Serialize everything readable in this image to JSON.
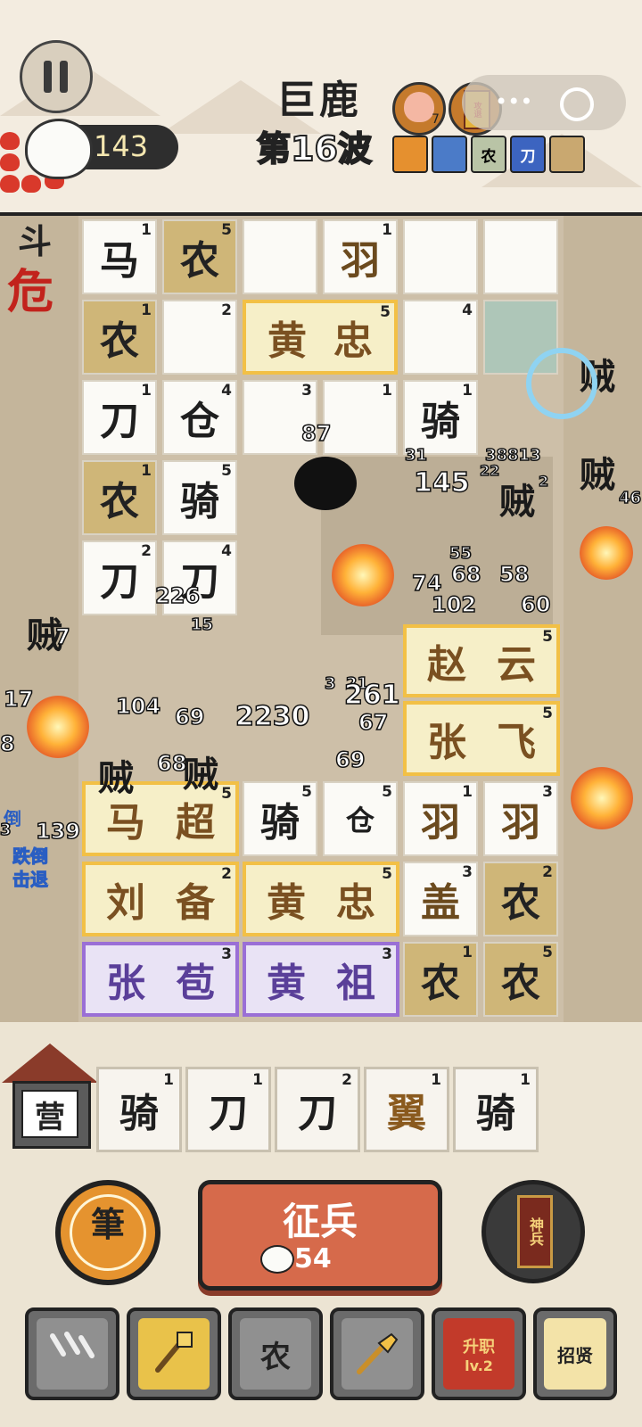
{
  "header": {
    "boss_name": "巨鹿",
    "wave": "第16波",
    "currency": "143",
    "peach_count": "7",
    "token_label": "攻退",
    "buffs": [
      "",
      "",
      "农",
      "刀",
      ""
    ],
    "capsule_dots": "•••"
  },
  "board": {
    "danger_label": "危",
    "danger_top": "斗",
    "cells": [
      {
        "text": "马",
        "lv": "1",
        "type": "plain"
      },
      {
        "text": "农",
        "lv": "5",
        "type": "farm"
      },
      {
        "text": "",
        "lv": "",
        "type": "plain"
      },
      {
        "text": "羽",
        "lv": "1",
        "type": "plain"
      },
      {
        "text": "",
        "lv": "",
        "type": "plain"
      },
      {
        "text": "",
        "lv": "",
        "type": "plain"
      },
      {
        "text": "农",
        "lv": "1",
        "type": "farm"
      },
      {
        "text": "",
        "lv": "2",
        "type": "plain"
      },
      {
        "text": "",
        "lv": "4",
        "type": "plain"
      },
      {
        "text": "刀",
        "lv": "1",
        "type": "plain"
      },
      {
        "text": "仓",
        "lv": "4",
        "type": "plain"
      },
      {
        "text": "",
        "lv": "3",
        "type": "plain"
      },
      {
        "text": "",
        "lv": "1",
        "type": "plain"
      },
      {
        "text": "骑",
        "lv": "1",
        "type": "plain"
      },
      {
        "text": "农",
        "lv": "1",
        "type": "farm"
      },
      {
        "text": "骑",
        "lv": "5",
        "type": "plain"
      },
      {
        "text": "刀",
        "lv": "2",
        "type": "plain"
      },
      {
        "text": "刀",
        "lv": "4",
        "type": "plain"
      }
    ],
    "hero_huangzhong_top": {
      "left": "黄",
      "right": "忠",
      "lv": "5"
    },
    "hero_zhaoyun": {
      "left": "赵",
      "right": "云",
      "lv": "5"
    },
    "hero_zhangfei": {
      "left": "张",
      "right": "飞",
      "lv": "5"
    },
    "hero_machao": {
      "left": "马",
      "right": "超",
      "lv": "5"
    },
    "hero_liubei": {
      "left": "刘",
      "right": "备",
      "lv": "2"
    },
    "hero_huangzhong": {
      "left": "黄",
      "right": "忠",
      "lv": "5"
    },
    "hero_zhangbao": {
      "left": "张",
      "right": "苞",
      "lv": "3"
    },
    "hero_huangzu": {
      "left": "黄",
      "right": "祖",
      "lv": "3"
    },
    "lower_cells": [
      {
        "text": "骑",
        "lv": "5",
        "type": "plain"
      },
      {
        "text": "仓",
        "lv": "5",
        "type": "plain"
      },
      {
        "text": "羽",
        "lv": "1",
        "type": "plain"
      },
      {
        "text": "羽",
        "lv": "3",
        "type": "plain"
      },
      {
        "text": "盖",
        "lv": "3",
        "type": "plain"
      },
      {
        "text": "农",
        "lv": "2",
        "type": "farm"
      },
      {
        "text": "农",
        "lv": "1",
        "type": "farm"
      },
      {
        "text": "农",
        "lv": "5",
        "type": "farm"
      }
    ],
    "enemies": [
      "贼",
      "贼",
      "贼",
      "贼",
      "贼",
      "贼"
    ],
    "status_labels": [
      "倒",
      "跌倒",
      "击退"
    ],
    "damage_numbers": [
      "38813",
      "145",
      "31",
      "22",
      "2",
      "55",
      "74",
      "68",
      "58",
      "102",
      "60",
      "226",
      "15",
      "87",
      "104",
      "69",
      "68",
      "2230",
      "3",
      "21",
      "261",
      "67",
      "69",
      "139",
      "7",
      "17",
      "8",
      "3",
      "46"
    ]
  },
  "bench": {
    "camp_label": "营",
    "slots": [
      {
        "text": "骑",
        "lv": "1"
      },
      {
        "text": "刀",
        "lv": "1"
      },
      {
        "text": "刀",
        "lv": "2"
      },
      {
        "text": "翼",
        "lv": "1"
      },
      {
        "text": "骑",
        "lv": "1"
      }
    ]
  },
  "actions": {
    "brush_label": "筆",
    "recruit_label": "征兵",
    "recruit_cost": "54",
    "weapon_label": "神兵"
  },
  "tools": {
    "farm_label": "农",
    "promote_label": "升职",
    "promote_level": "lv.2",
    "hire_label": "招贤"
  }
}
